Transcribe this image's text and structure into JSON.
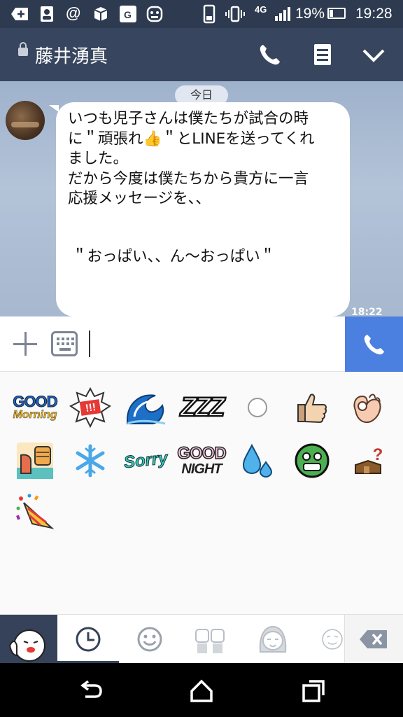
{
  "status_bar": {
    "network": "4G",
    "battery": "19%",
    "time": "19:28",
    "icons": [
      "add-icon",
      "contacts-icon",
      "at-icon",
      "box-icon",
      "maps-icon",
      "android-icon",
      "phone-icon",
      "vibrate-icon",
      "network-icon",
      "signal-icon",
      "battery-icon"
    ]
  },
  "header": {
    "title": "藤井湧真",
    "icons": [
      "lock-icon",
      "phone-icon",
      "notes-icon",
      "chevron-down-icon"
    ]
  },
  "chat": {
    "date_label": "今日",
    "message": {
      "lines": [
        "いつも児子さんは僕たちが試合の時",
        "に＂頑張れ👍＂とLINEを送ってくれ",
        "ました。",
        "だから今度は僕たちから貴方に一言",
        "応援メッセージを、、",
        "＂おっぱい、、ん〜おっぱい＂"
      ],
      "time": "18:22"
    }
  },
  "input": {
    "placeholder": ""
  },
  "stickers": {
    "good_morning_top": "GOOD",
    "good_morning_bottom": "Morning",
    "exclaim": "!!!",
    "zzz": "ZZZ",
    "sorry": "Sorry",
    "good_night_top": "GOOD",
    "good_night_bottom": "NIGHT",
    "question": "?"
  },
  "colors": {
    "status_bar": "#2d3a4f",
    "header": "#37455e",
    "call_button": "#4b7fe0",
    "bubble": "#ffffff"
  }
}
